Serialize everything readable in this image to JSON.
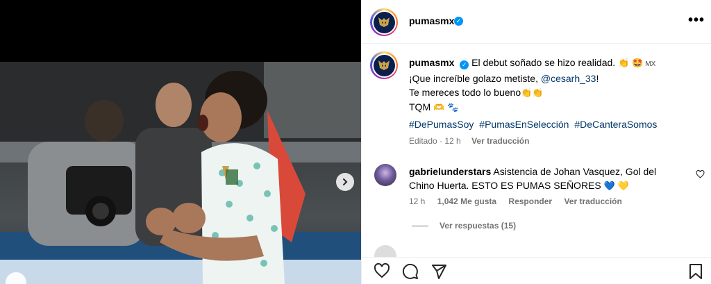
{
  "post": {
    "username": "pumasmx",
    "verified": "✓",
    "more": "•••",
    "avatar_logo": "PUMAS",
    "caption": {
      "line1_text": "El debut soñado se hizo realidad.",
      "line1_flag": "MX",
      "line2_prefix": "¡Que increíble golazo metiste, ",
      "line2_mention": "@cesarh_33",
      "line2_suffix": "!",
      "line3": "Te mereces todo lo bueno",
      "line4": "TQM",
      "hashtags": [
        "#DePumasSoy",
        "#PumasEnSelección",
        "#DeCanteraSomos"
      ],
      "edited": "Editado · 12 h",
      "see_translation": "Ver traducción"
    }
  },
  "comment": {
    "username": "gabrielunderstars",
    "text": "Asistencia de Johan Vasquez, Gol del Chino Huerta. ESTO ES PUMAS SEÑORES",
    "time": "12 h",
    "likes": "1,042 Me gusta",
    "reply": "Responder",
    "see_translation": "Ver traducción",
    "view_replies": "Ver respuestas (15)"
  },
  "icons": {
    "like": "heart-icon",
    "comment": "comment-icon",
    "share": "share-icon",
    "save": "bookmark-icon",
    "next": "chevron-right-icon"
  },
  "colors": {
    "link": "#00376b",
    "muted": "#737373",
    "verified": "#0095f6",
    "divider": "#efefef"
  }
}
